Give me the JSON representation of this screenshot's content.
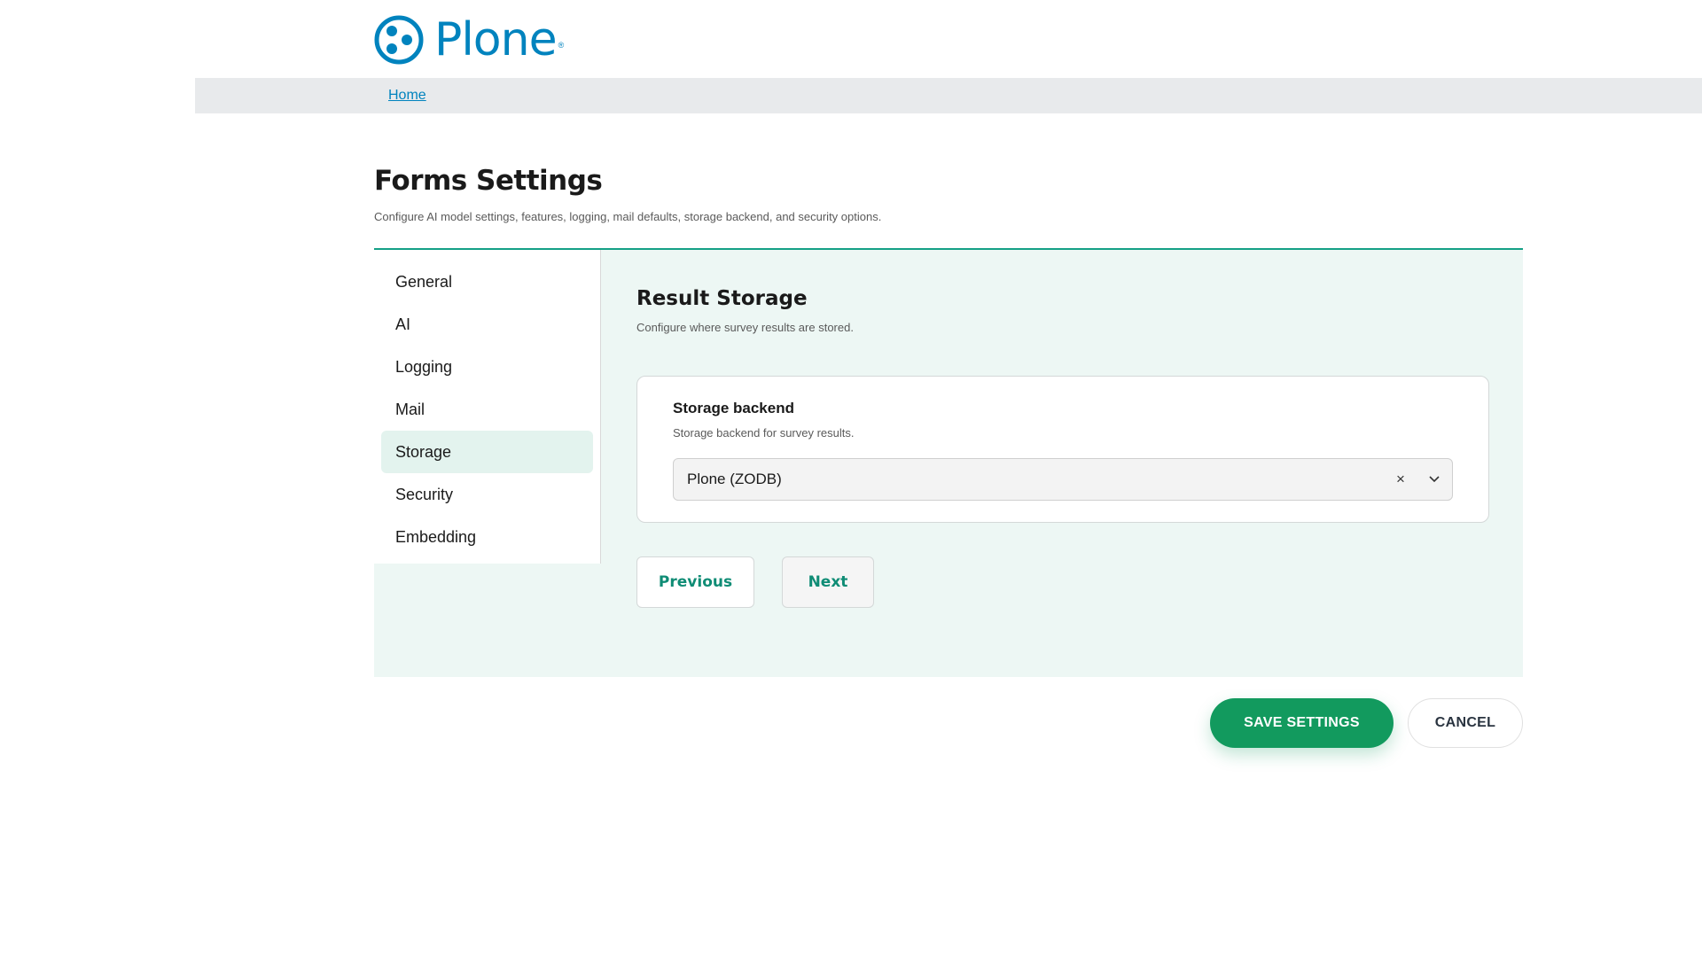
{
  "brand": {
    "name": "Plone",
    "registered_mark": "®",
    "color": "#0083be"
  },
  "breadcrumb": {
    "home_label": "Home"
  },
  "page": {
    "title": "Forms Settings",
    "description": "Configure AI model settings, features, logging, mail defaults, storage backend, and security options."
  },
  "sidebar": {
    "items": [
      {
        "label": "General"
      },
      {
        "label": "AI"
      },
      {
        "label": "Logging"
      },
      {
        "label": "Mail"
      },
      {
        "label": "Storage"
      },
      {
        "label": "Security"
      },
      {
        "label": "Embedding"
      }
    ],
    "active": "Storage"
  },
  "section": {
    "title": "Result Storage",
    "description": "Configure where survey results are stored."
  },
  "storage_field": {
    "label": "Storage backend",
    "help": "Storage backend for survey results.",
    "value": "Plone (ZODB)",
    "clear_symbol": "×"
  },
  "navigation": {
    "previous_label": "Previous",
    "next_label": "Next"
  },
  "actions": {
    "save_label": "SAVE SETTINGS",
    "cancel_label": "CANCEL"
  },
  "colors": {
    "accent": "#15a086",
    "panel_bg": "#edf7f4",
    "save_bg": "#129a5e"
  }
}
